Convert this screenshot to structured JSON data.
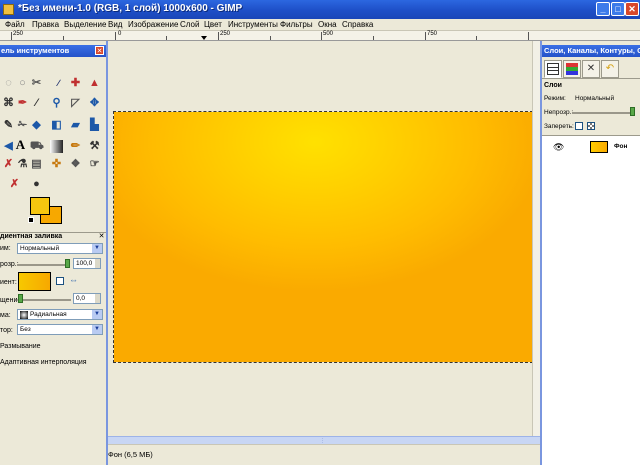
{
  "window": {
    "title": "*Без имени-1.0 (RGB, 1 слой) 1000x600 - GIMP",
    "minimize": "_",
    "maximize": "□",
    "close": "✕"
  },
  "menu": {
    "items": [
      "Файл",
      "Правка",
      "Выделение",
      "Вид",
      "Изображение",
      "Слой",
      "Цвет",
      "Инструменты",
      "Фильтры",
      "Окна",
      "Справка"
    ]
  },
  "ruler": {
    "labels": [
      "250",
      "0",
      "250",
      "500",
      "750"
    ]
  },
  "toolbox": {
    "title": "ель инструментов",
    "close": "✕",
    "tool_icons": [
      "lasso-icon",
      "fuzzy-select-icon",
      "scissors-select-icon",
      "paths-icon",
      "color-picker-icon",
      "zoom-icon",
      "measure-icon",
      "move-icon",
      "align-icon",
      "crop-icon",
      "rotate-icon",
      "scale-icon",
      "shear-icon",
      "perspective-icon",
      "flip-icon",
      "text-icon",
      "bucket-fill-icon",
      "blend-icon",
      "pencil-icon",
      "paintbrush-icon",
      "airbrush-icon",
      "ink-icon",
      "clone-icon",
      "heal-icon",
      "perspective-clone-icon",
      "smudge-icon",
      "dodge-burn-icon",
      "eraser-icon"
    ],
    "options_title": "диентная заливка",
    "options_close": "✕",
    "mode_label": "им:",
    "mode_value": "Нормальный",
    "opacity_label": "розр.:",
    "opacity_value": "100,0",
    "gradient_label": "иент:",
    "offset_label": "щение:",
    "offset_value": "0,0",
    "shape_label": "ма:",
    "shape_value": "Радиальная",
    "repeat_label": "тор:",
    "repeat_value": "Без",
    "dither_label": "Размывание",
    "adaptive_label": "Адаптивная интерполяция",
    "fg_color": "#F6C60F",
    "bg_color": "#F7A800"
  },
  "status": {
    "text": "Фон (6,5 МБ)"
  },
  "dock": {
    "title": "Слои, Каналы, Контуры, От",
    "tab_icons": [
      "layers-tab-icon",
      "channels-tab-icon",
      "paths-tab-icon",
      "undo-tab-icon"
    ],
    "section_title": "Слои",
    "mode_label": "Режим:",
    "mode_value": "Нормальный",
    "opacity_label": "Непрозр.:",
    "lock_label": "Запереть:",
    "layer_name": "Фон"
  }
}
